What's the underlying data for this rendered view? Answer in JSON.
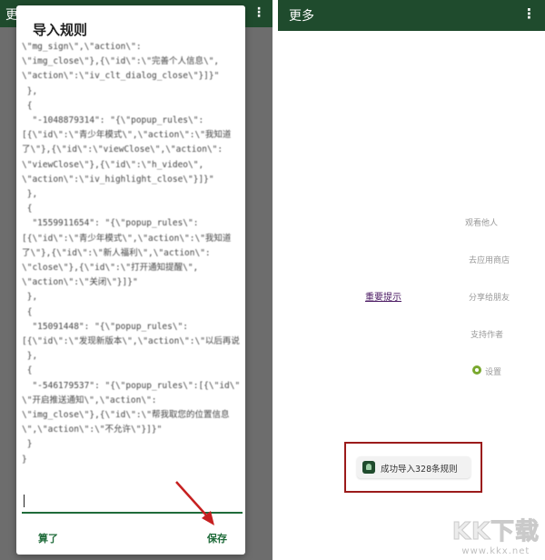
{
  "left": {
    "appbar_title": "更",
    "dialog": {
      "title": "导入规则",
      "rules_text": "\\\"mg_sign\\\",\\\"action\\\":\n\\\"img_close\\\"},{\\\"id\\\":\\\"完善个人信息\\\",\n\\\"action\\\":\\\"iv_clt_dialog_close\\\"}]}\"\n },\n {\n  \"-1048879314\": \"{\\\"popup_rules\\\":\n[{\\\"id\\\":\\\"青少年模式\\\",\\\"action\\\":\\\"我知道\n了\\\"},{\\\"id\\\":\\\"viewClose\\\",\\\"action\\\":\n\\\"viewClose\\\"},{\\\"id\\\":\\\"h_video\\\",\n\\\"action\\\":\\\"iv_highlight_close\\\"}]}\"\n },\n {\n  \"1559911654\": \"{\\\"popup_rules\\\":\n[{\\\"id\\\":\\\"青少年模式\\\",\\\"action\\\":\\\"我知道\n了\\\"},{\\\"id\\\":\\\"新人福利\\\",\\\"action\\\":\n\\\"close\\\"},{\\\"id\\\":\\\"打开通知提醒\\\",\n\\\"action\\\":\\\"关闭\\\"}]}\"\n },\n {\n  \"15091448\": \"{\\\"popup_rules\\\":\n[{\\\"id\\\":\\\"发现新版本\\\",\\\"action\\\":\\\"以后再说\\\"}]}\"\n },\n {\n  \"-546179537\": \"{\\\"popup_rules\\\":[{\\\"id\\\":\n\\\"开启推送通知\\\",\\\"action\\\":\n\\\"img_close\\\"},{\\\"id\\\":\\\"帮我取您的位置信息\n\\\",\\\"action\\\":\\\"不允许\\\"}]}\"\n }\n}",
      "cancel_label": "算了",
      "save_label": "保存"
    }
  },
  "right": {
    "appbar_title": "更多",
    "important_link": "重要提示",
    "menu": {
      "item1": "观看他人",
      "item2": "去应用商店",
      "item3": "分享给朋友",
      "item4": "支持作者",
      "settings": "设置"
    },
    "toast_text": "成功导入328条规则"
  },
  "watermark": {
    "logo": "KK下载",
    "url": "www.kkx.net"
  },
  "colors": {
    "appbar": "#1f4b2d",
    "accent": "#1f6b3a",
    "highlight_box": "#9b1b1b",
    "link": "#4b1a63"
  }
}
